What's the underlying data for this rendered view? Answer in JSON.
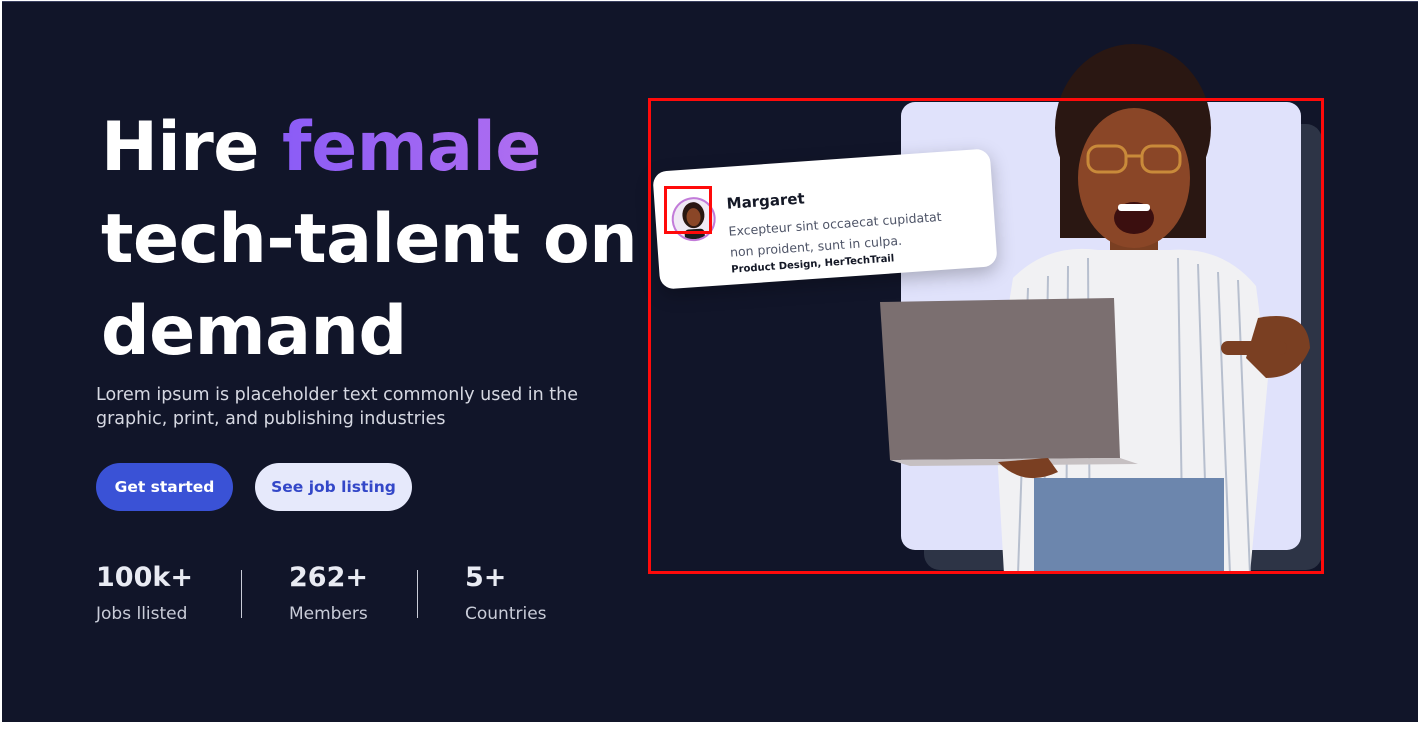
{
  "hero": {
    "headline_prefix": "Hire ",
    "headline_accent": "female",
    "headline_suffix": "tech-talent on demand",
    "subtitle": "Lorem ipsum is placeholder text commonly used in the graphic, print, and publishing industries",
    "primary_button": "Get started",
    "secondary_button": "See job listing"
  },
  "stats": [
    {
      "value": "100k+",
      "label": "Jobs llisted"
    },
    {
      "value": "262+",
      "label": "Members"
    },
    {
      "value": "5+",
      "label": "Countries"
    }
  ],
  "profile_card": {
    "name": "Margaret",
    "quote": "Excepteur sint occaecat cupidatat non proident, sunt in culpa.",
    "role": "Product Design, HerTechTrail"
  },
  "colors": {
    "background": "#111529",
    "accent_gradient_start": "#8b5cf6",
    "primary_button": "#3a52d6",
    "secondary_button": "#e6e9fb",
    "selection_highlight": "#ff0a0a"
  },
  "icons": {
    "avatar": "woman-avatar-photo",
    "hero_image": "woman-with-laptop-photo"
  }
}
